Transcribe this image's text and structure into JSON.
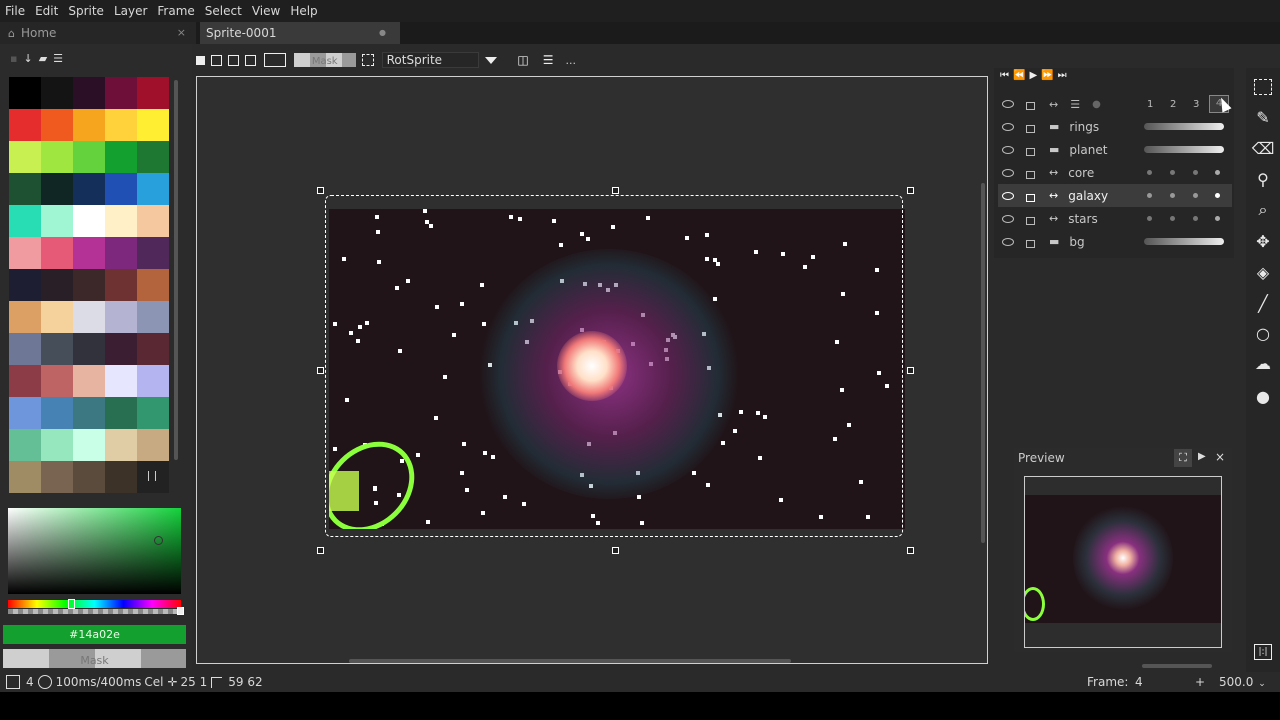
{
  "menu": [
    "File",
    "Edit",
    "Sprite",
    "Layer",
    "Frame",
    "Select",
    "View",
    "Help"
  ],
  "tabs": {
    "home": "Home",
    "sprite": "Sprite-0001",
    "close": "×",
    "dot": "●"
  },
  "toolbar": {
    "mask_label": "Mask",
    "rotation_algorithm": "RotSprite",
    "more": "..."
  },
  "palette": {
    "colors": [
      "#000000",
      "#141414",
      "#2a0f26",
      "#6e0f3a",
      "#a0102a",
      "#e52d2d",
      "#f05a1e",
      "#f5a51e",
      "#ffd23c",
      "#ffee32",
      "#c8f050",
      "#a0e641",
      "#64d23c",
      "#14a02e",
      "#1e7832",
      "#1e5032",
      "#102624",
      "#14305a",
      "#2050b4",
      "#28a0dc",
      "#28dcb4",
      "#a0f5d2",
      "#ffffff",
      "#fff0c8",
      "#f5c8a0",
      "#f09ba0",
      "#e65a78",
      "#b43296",
      "#7d287d",
      "#50285a",
      "#1e1e32",
      "#282026",
      "#3c2828",
      "#6e3232",
      "#b4643c",
      "#dca064",
      "#f5d29b",
      "#dcdce6",
      "#b4b4d2",
      "#8c96b4",
      "#6e7896",
      "#464e5a",
      "#32323c",
      "#3c1e32",
      "#5a2832",
      "#8c3c46",
      "#be6464",
      "#e6b4a0",
      "#e6e6ff",
      "#b4b4f0",
      "#6e96dc",
      "#4682b4",
      "#3c7882",
      "#286e50",
      "#32966e",
      "#64be96",
      "#96e6be",
      "#c8ffe6",
      "#e1cda5",
      "#c8aa82",
      "#a08c64",
      "#786450",
      "#5a4b3c",
      "#3c3228"
    ]
  },
  "color_picker": {
    "hex": "#14a02e",
    "mask": "Mask"
  },
  "timeline": {
    "frame_numbers": [
      "1",
      "2",
      "3",
      "4"
    ],
    "layers": [
      {
        "name": "rings",
        "selected": false,
        "opacity": 0.9
      },
      {
        "name": "planet",
        "selected": false,
        "opacity": 0.9
      },
      {
        "name": "core",
        "selected": false
      },
      {
        "name": "galaxy",
        "selected": true
      },
      {
        "name": "stars",
        "selected": false
      },
      {
        "name": "bg",
        "selected": false,
        "opacity": 0.9
      }
    ]
  },
  "preview": {
    "title": "Preview"
  },
  "status": {
    "frame_num": "4",
    "duration": "100ms/400ms",
    "cel": "Cel",
    "pos": "25 1",
    "size": "59 62",
    "frame_label": "Frame:",
    "frame_value": "4",
    "plus": "+",
    "zoom": "500.0"
  },
  "colors": {
    "accent": "#14a02e",
    "canvas_bg": "#201418"
  }
}
